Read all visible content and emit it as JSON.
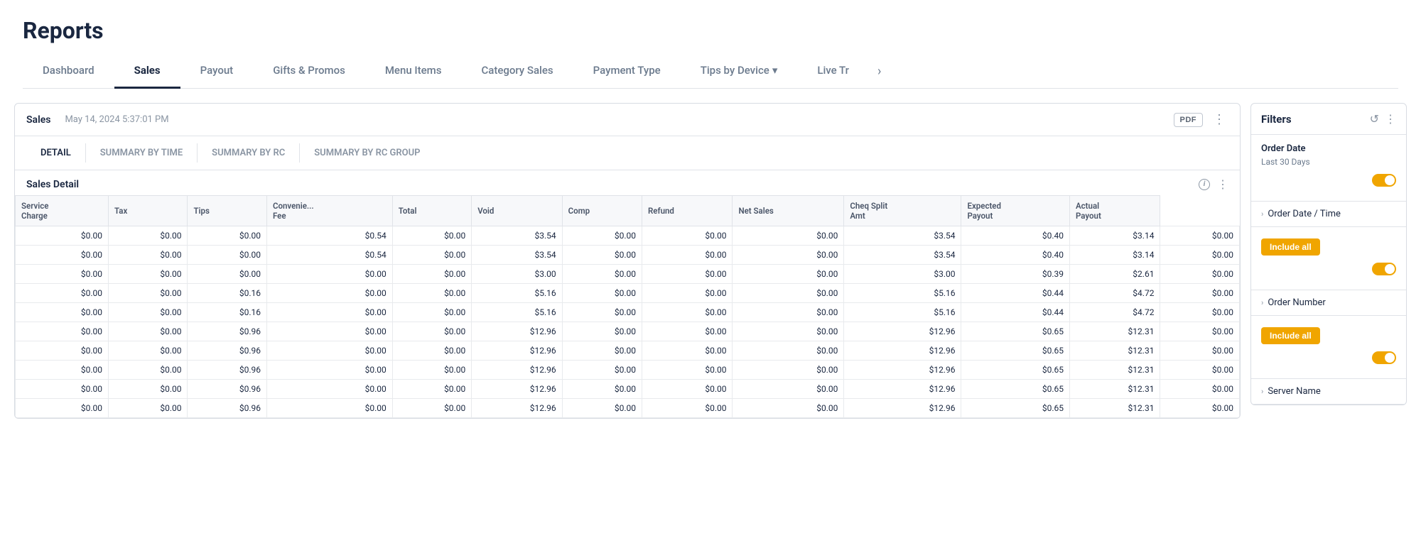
{
  "page": {
    "title": "Reports"
  },
  "nav": {
    "tabs": [
      {
        "id": "dashboard",
        "label": "Dashboard",
        "active": false
      },
      {
        "id": "sales",
        "label": "Sales",
        "active": true
      },
      {
        "id": "payout",
        "label": "Payout",
        "active": false
      },
      {
        "id": "gifts-promos",
        "label": "Gifts & Promos",
        "active": false
      },
      {
        "id": "menu-items",
        "label": "Menu Items",
        "active": false
      },
      {
        "id": "category-sales",
        "label": "Category Sales",
        "active": false
      },
      {
        "id": "payment-type",
        "label": "Payment Type",
        "active": false
      },
      {
        "id": "tips-by-device",
        "label": "Tips by Device",
        "active": false
      },
      {
        "id": "live-tr",
        "label": "Live Tr",
        "active": false
      }
    ],
    "more_icon": "›"
  },
  "report": {
    "label": "Sales",
    "timestamp": "May 14, 2024 5:37:01 PM",
    "pdf_label": "PDF",
    "sub_tabs": [
      {
        "id": "detail",
        "label": "DETAIL",
        "active": true
      },
      {
        "id": "summary-by-time",
        "label": "SUMMARY BY TIME",
        "active": false
      },
      {
        "id": "summary-by-rc",
        "label": "SUMMARY BY RC",
        "active": false
      },
      {
        "id": "summary-by-rc-group",
        "label": "SUMMARY BY RC GROUP",
        "active": false
      }
    ],
    "table_title": "Sales Detail",
    "columns": [
      "Service Charge",
      "Tax",
      "Tips",
      "Convenie... Fee",
      "Total",
      "Void",
      "Comp",
      "Refund",
      "Net Sales",
      "Cheq Split Amt",
      "Expected Payout",
      "Actual Payout"
    ],
    "rows": [
      [
        "$0.00",
        "$0.00",
        "$0.00",
        "$0.54",
        "$0.00",
        "$3.54",
        "$0.00",
        "$0.00",
        "$0.00",
        "$3.54",
        "$0.40",
        "$3.14",
        "$0.00"
      ],
      [
        "$0.00",
        "$0.00",
        "$0.00",
        "$0.54",
        "$0.00",
        "$3.54",
        "$0.00",
        "$0.00",
        "$0.00",
        "$3.54",
        "$0.40",
        "$3.14",
        "$0.00"
      ],
      [
        "$0.00",
        "$0.00",
        "$0.00",
        "$0.00",
        "$0.00",
        "$3.00",
        "$0.00",
        "$0.00",
        "$0.00",
        "$3.00",
        "$0.39",
        "$2.61",
        "$0.00"
      ],
      [
        "$0.00",
        "$0.00",
        "$0.16",
        "$0.00",
        "$0.00",
        "$5.16",
        "$0.00",
        "$0.00",
        "$0.00",
        "$5.16",
        "$0.44",
        "$4.72",
        "$0.00"
      ],
      [
        "$0.00",
        "$0.00",
        "$0.16",
        "$0.00",
        "$0.00",
        "$5.16",
        "$0.00",
        "$0.00",
        "$0.00",
        "$5.16",
        "$0.44",
        "$4.72",
        "$0.00"
      ],
      [
        "$0.00",
        "$0.00",
        "$0.96",
        "$0.00",
        "$0.00",
        "$12.96",
        "$0.00",
        "$0.00",
        "$0.00",
        "$12.96",
        "$0.65",
        "$12.31",
        "$0.00"
      ],
      [
        "$0.00",
        "$0.00",
        "$0.96",
        "$0.00",
        "$0.00",
        "$12.96",
        "$0.00",
        "$0.00",
        "$0.00",
        "$12.96",
        "$0.65",
        "$12.31",
        "$0.00"
      ],
      [
        "$0.00",
        "$0.00",
        "$0.96",
        "$0.00",
        "$0.00",
        "$12.96",
        "$0.00",
        "$0.00",
        "$0.00",
        "$12.96",
        "$0.65",
        "$12.31",
        "$0.00"
      ],
      [
        "$0.00",
        "$0.00",
        "$0.96",
        "$0.00",
        "$0.00",
        "$12.96",
        "$0.00",
        "$0.00",
        "$0.00",
        "$12.96",
        "$0.65",
        "$12.31",
        "$0.00"
      ],
      [
        "$0.00",
        "$0.00",
        "$0.96",
        "$0.00",
        "$0.00",
        "$12.96",
        "$0.00",
        "$0.00",
        "$0.00",
        "$12.96",
        "$0.65",
        "$12.31",
        "$0.00"
      ]
    ]
  },
  "filters": {
    "title": "Filters",
    "order_date_label": "Order Date",
    "order_date_value": "Last 30 Days",
    "include_all_label": "Include all",
    "order_date_time_label": "Order Date / Time",
    "order_number_label": "Order Number",
    "server_name_label": "Server Name"
  }
}
